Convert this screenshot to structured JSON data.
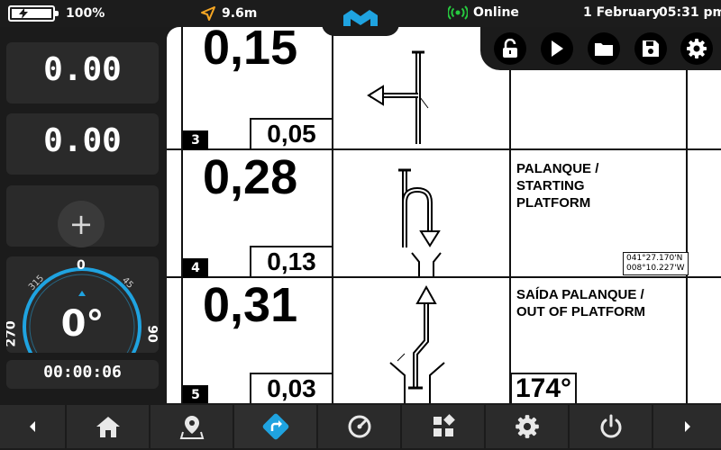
{
  "status_bar": {
    "battery_percent_label": "100%",
    "battery_level": 1.0,
    "distance": "9.6m",
    "connection_status": "Online",
    "date": "1 February",
    "time": "05:31 pm",
    "accent_green": "#27c93f",
    "accent_orange": "#f5a623",
    "brand_blue": "#1fa3e0"
  },
  "left_panel": {
    "counter_1": "0.00",
    "counter_2": "0.00",
    "add_label": "+",
    "compass": {
      "heading": "0°",
      "heading_value": 0,
      "labels": {
        "n": "0",
        "e": "90",
        "w": "270",
        "ne": "45",
        "nw": "315"
      }
    },
    "timer": "00:00:06"
  },
  "toolbar": {
    "icons": [
      "unlock-icon",
      "play-icon",
      "folder-icon",
      "save-icon",
      "gear-icon"
    ]
  },
  "roadbook": {
    "rows": [
      {
        "step": "3",
        "total": "0,15",
        "partial": "0,05",
        "notes": [],
        "gps": [],
        "heading": ""
      },
      {
        "step": "4",
        "total": "0,28",
        "partial": "0,13",
        "notes": [
          "PALANQUE /",
          "STARTING",
          "PLATFORM"
        ],
        "gps": [
          "041°27.170'N",
          "008°10.227'W"
        ],
        "heading": ""
      },
      {
        "step": "5",
        "total": "0,31",
        "partial": "0,03",
        "notes": [
          "SAÍDA PALANQUE /",
          "OUT OF PLATFORM"
        ],
        "gps": [],
        "heading": "174°"
      }
    ]
  },
  "bottom_nav": {
    "items": [
      "chevron-left-icon",
      "home-icon",
      "map-pin-icon",
      "route-icon",
      "gauge-icon",
      "widgets-icon",
      "gear-icon",
      "power-icon",
      "chevron-right-icon"
    ],
    "active_index": 3
  }
}
